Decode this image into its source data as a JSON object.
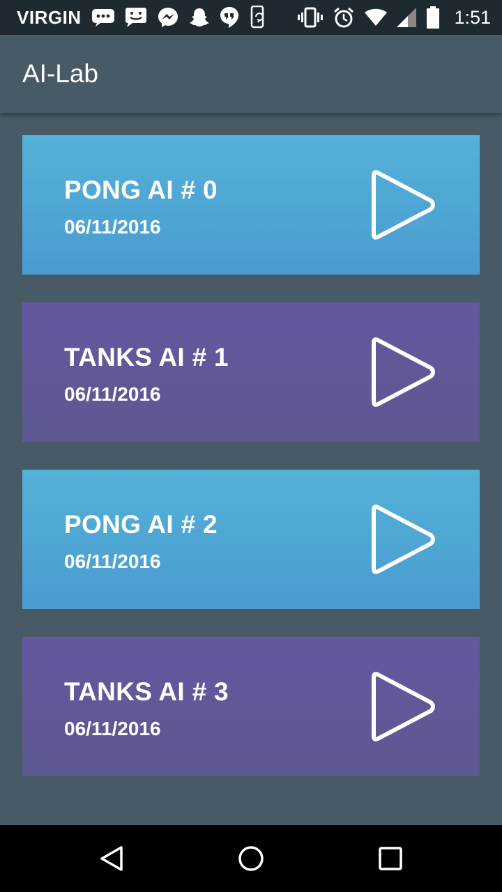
{
  "status_bar": {
    "carrier": "VIRGIN",
    "time": "1:51",
    "notification_icons": [
      "messages-icon",
      "chat-icon",
      "messenger-icon",
      "snapchat-icon",
      "hangouts-icon",
      "phone-sync-icon"
    ],
    "system_icons": [
      "vibrate-icon",
      "alarm-icon",
      "wifi-icon",
      "signal-icon",
      "battery-icon"
    ]
  },
  "app_bar": {
    "title": "AI-Lab"
  },
  "cards": [
    {
      "title": "PONG AI # 0",
      "date": "06/11/2016",
      "kind": "pong"
    },
    {
      "title": "TANKS AI # 1",
      "date": "06/11/2016",
      "kind": "tanks"
    },
    {
      "title": "PONG AI # 2",
      "date": "06/11/2016",
      "kind": "pong"
    },
    {
      "title": "TANKS AI # 3",
      "date": "06/11/2016",
      "kind": "tanks"
    }
  ],
  "colors": {
    "background": "#475a66",
    "pong_top": "#53b2d8",
    "pong_bottom": "#4a9bd0",
    "tanks_top": "#6657a0",
    "tanks_bottom": "#5c5890"
  },
  "nav_bar": {
    "buttons": [
      "back-icon",
      "home-icon",
      "recent-apps-icon"
    ]
  }
}
